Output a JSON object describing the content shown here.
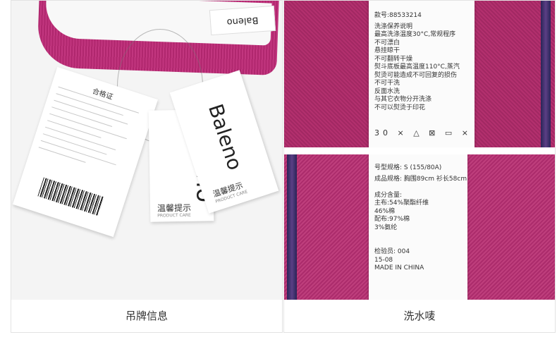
{
  "left_panel": {
    "caption": "吊牌信息",
    "neck_label": "Baleno",
    "cert_tag_title": "合格证",
    "care_tag_title": "温馨提示",
    "care_tag_subtitle": "PRODUCT CARE",
    "brand_logo": "Baleno",
    "brand_tag_title": "温馨提示",
    "brand_tag_subtitle": "PRODUCT CARE"
  },
  "right_panel": {
    "caption": "洗水唛",
    "top_label_lines": [
      "款号:88533214",
      "洗涤保养说明",
      "最高洗涤温度30°C,常规程序",
      "不可漂白",
      "悬挂晾干",
      "不可翻转干燥",
      "熨斗底板最高温度110°C,蒸汽",
      "熨烫可能造成不可回复的损伤",
      "不可干洗",
      "反面水洗",
      "与其它衣物分开洗涤",
      "不可以熨烫于印花"
    ],
    "care_icons": "30 ⨯ △ ⊠ ▭ ⨯",
    "bottom_label_lines": [
      "号型规格: S (155/80A)",
      "成品规格: 胸围89cm 衫长58cm",
      "",
      "成分含量:",
      "主布:54%聚酯纤维",
      "      46%棉",
      "配布:97%棉",
      "      3%氨纶",
      "",
      "",
      "检验员: 004",
      "15-08",
      "MADE IN CHINA"
    ]
  }
}
